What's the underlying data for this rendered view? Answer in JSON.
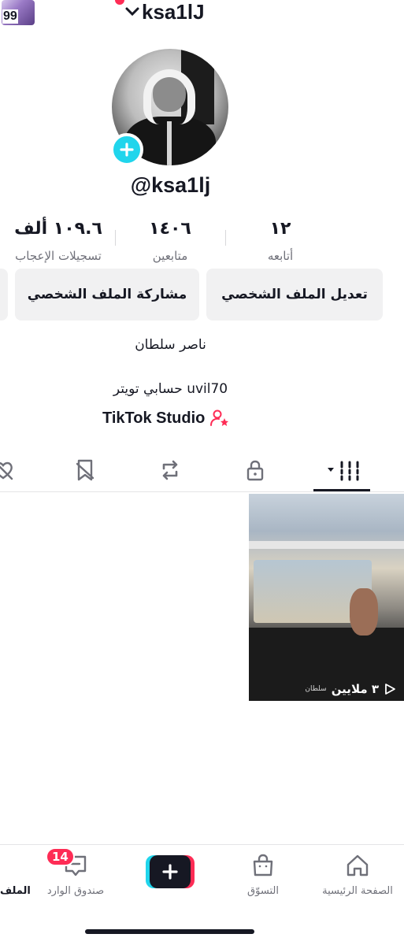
{
  "top_bar": {
    "story_count": "99",
    "username": "ksa1lJ"
  },
  "profile": {
    "handle": "@ksa1lj",
    "stats": [
      {
        "value": "١٢",
        "label": "أتابعه"
      },
      {
        "value": "١٤٠٦",
        "label": "متابعين"
      },
      {
        "value": "١٠٩.٦ ألف",
        "label": "تسجيلات الإعجاب"
      }
    ],
    "buttons": {
      "edit": "تعديل الملف الشخصي",
      "share": "مشاركة الملف الشخصي"
    },
    "display_name": "ناصر سلطان",
    "bio": "حسابي تويتر uvil70",
    "studio_link": "TikTok Studio"
  },
  "tabs": [
    "videos-grid",
    "private",
    "reposts",
    "favorites",
    "liked"
  ],
  "videos": [
    {
      "views": "٣ ملايين",
      "caption": "سلطان"
    }
  ],
  "bottom_nav": {
    "home": "الصفحة الرئيسية",
    "shop": "التسوّق",
    "inbox": "صندوق الوارد",
    "inbox_badge": "14",
    "profile_cut": "الملف"
  },
  "colors": {
    "accent_pink": "#fe2c55",
    "accent_cyan": "#20d5ec",
    "text": "#161823"
  }
}
